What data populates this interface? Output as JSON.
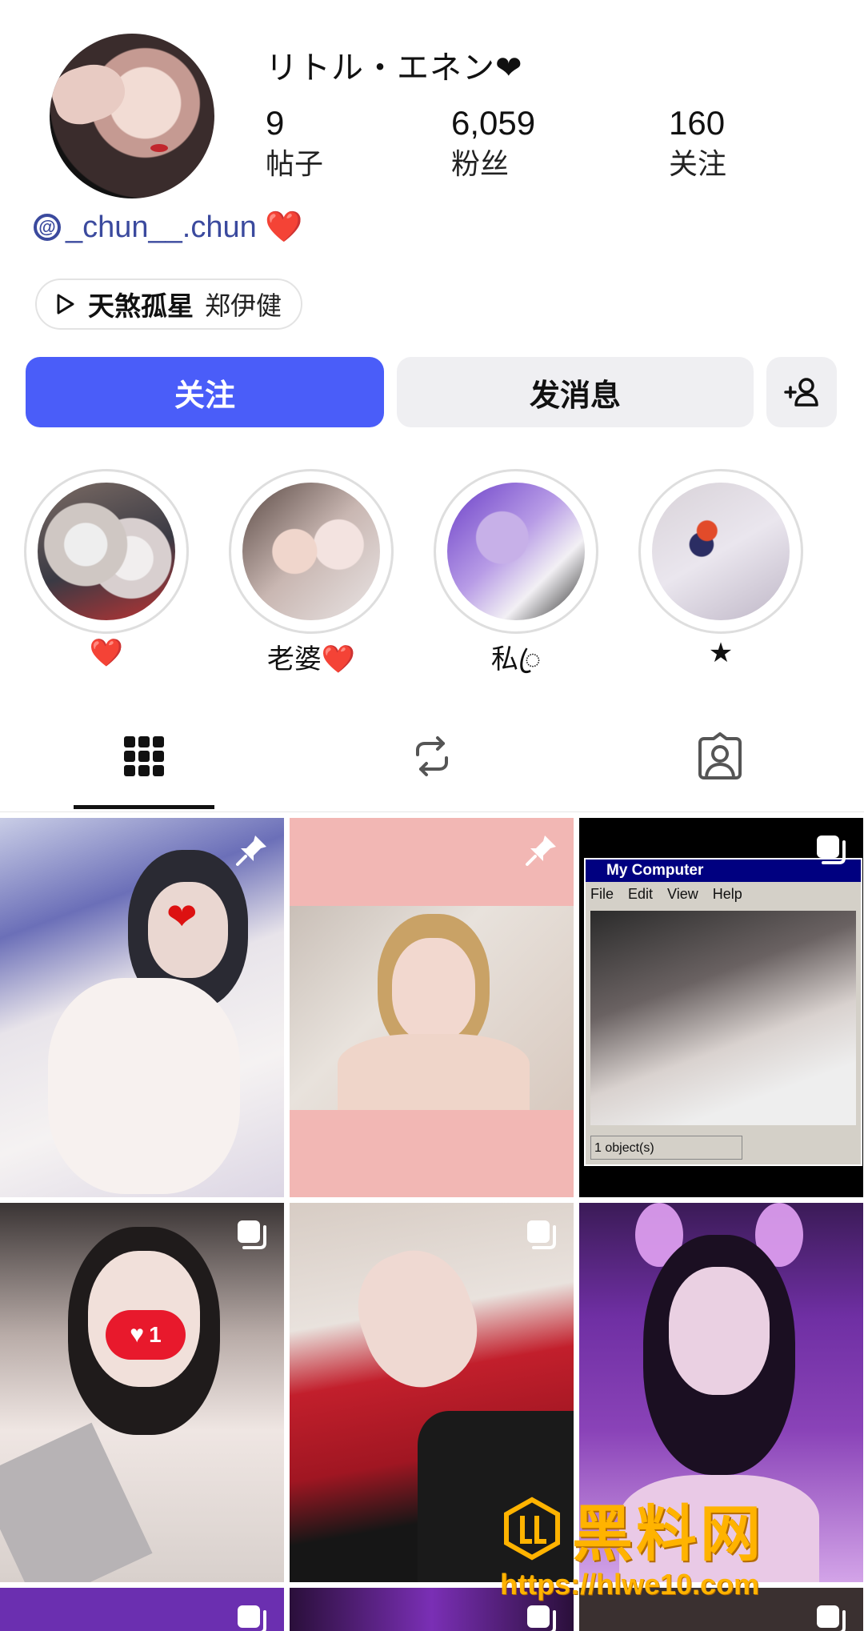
{
  "profile": {
    "name": "リトル・エネン❤",
    "stats": [
      {
        "value": "9",
        "label": "帖子"
      },
      {
        "value": "6,059",
        "label": "粉丝"
      },
      {
        "value": "160",
        "label": "关注"
      }
    ],
    "threads_handle": "_chun__.chun ❤️",
    "music": {
      "song": "天煞孤星",
      "artist": "郑伊健"
    }
  },
  "actions": {
    "follow": "关注",
    "message": "发消息"
  },
  "highlights": [
    {
      "label": "❤️"
    },
    {
      "label": "老婆❤️"
    },
    {
      "label": "私ꦿ"
    },
    {
      "label": "★"
    }
  ],
  "grid": {
    "posts": [
      {
        "badge": "pinned"
      },
      {
        "badge": "pinned"
      },
      {
        "badge": "carousel",
        "screen_title": "My Computer",
        "menu": [
          "File",
          "Edit",
          "View",
          "Help"
        ],
        "status": "1 object(s)"
      },
      {
        "badge": "carousel",
        "like_count": "1"
      },
      {
        "badge": "carousel"
      },
      {
        "badge": "none"
      }
    ]
  },
  "watermark": {
    "text": "黑料网",
    "url": "https://hlwe10.com"
  },
  "colors": {
    "accent": "#4a5df9",
    "threads_link": "#3b4a9e",
    "watermark": "#ffb300"
  }
}
